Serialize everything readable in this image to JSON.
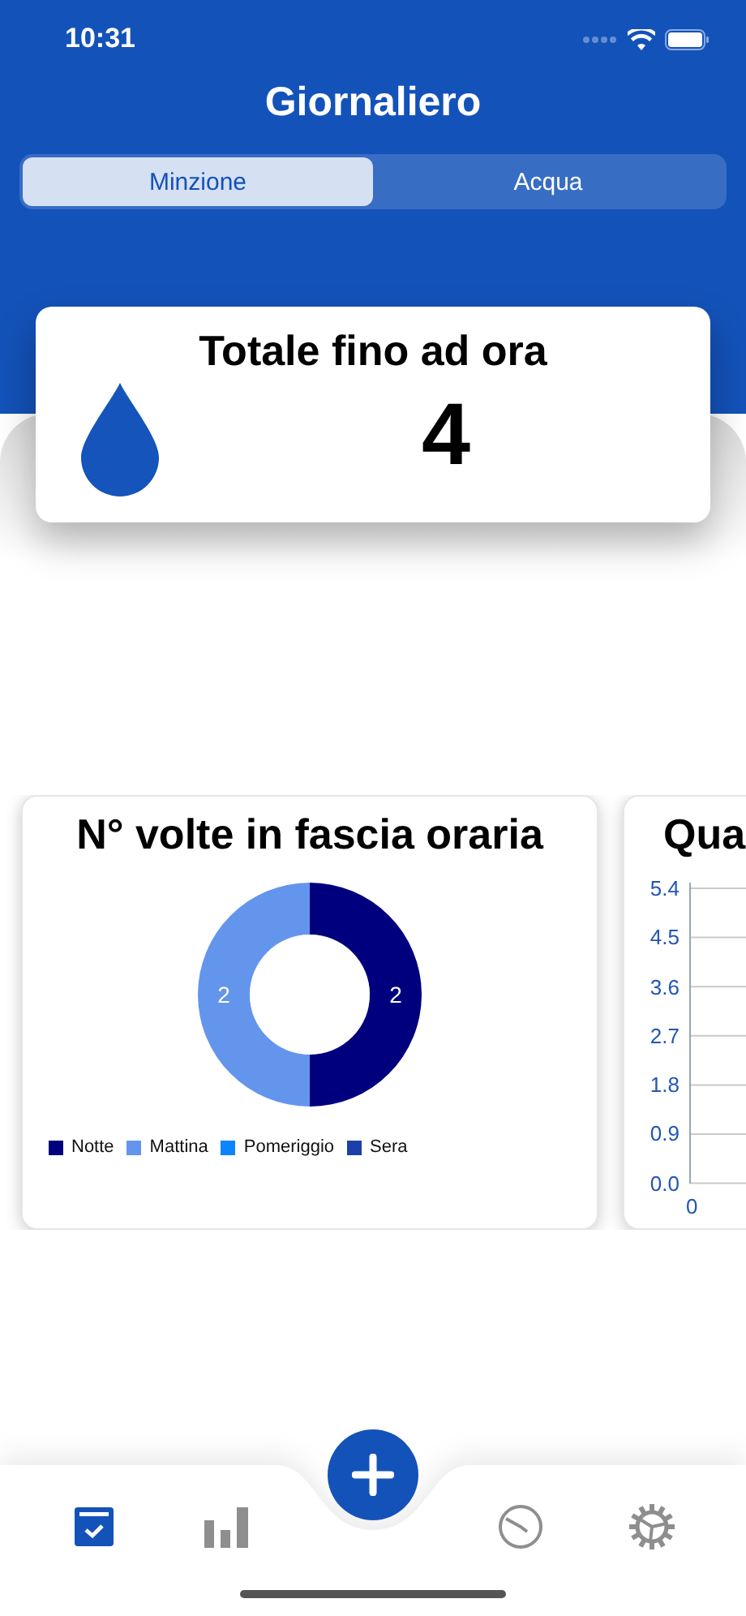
{
  "status_bar": {
    "time": "10:31"
  },
  "header": {
    "title": "Giornaliero"
  },
  "segments": [
    {
      "label": "Minzione",
      "selected": true
    },
    {
      "label": "Acqua",
      "selected": false
    }
  ],
  "summary": {
    "title": "Totale fino ad ora",
    "value": "4"
  },
  "time_slot_card": {
    "title": "N° volte in fascia oraria",
    "chart_data": {
      "type": "donut",
      "categories": [
        "Notte",
        "Mattina",
        "Pomeriggio",
        "Sera"
      ],
      "values": [
        2,
        2,
        0,
        0
      ],
      "colors": [
        "#00007f",
        "#6495ed",
        "#0a84ff",
        "#1c3fa8"
      ],
      "data_labels": true,
      "legend": true
    }
  },
  "quantity_card": {
    "title": "Qua",
    "y_ticks": [
      "5.4",
      "4.5",
      "3.6",
      "2.7",
      "1.8",
      "0.9",
      "0.0"
    ],
    "x_ticks": [
      "0"
    ]
  },
  "tab_bar": {
    "tabs": [
      {
        "kind": "calendar",
        "selected": true
      },
      {
        "kind": "stats",
        "selected": false
      },
      {
        "kind": "clock",
        "selected": false
      },
      {
        "kind": "settings",
        "selected": false
      }
    ]
  }
}
